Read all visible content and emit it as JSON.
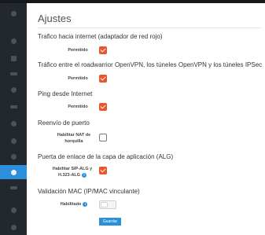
{
  "page": {
    "title": "Ajustes"
  },
  "sidebar": {
    "icons": [
      "globe-icon",
      "shield-icon",
      "shuffle-icon",
      "users-icon",
      "list-icon",
      "chart-icon",
      "pulse-icon",
      "link-icon",
      "gear-icon",
      "stack-icon",
      "search-icon",
      "info-icon"
    ],
    "active_icon": "gear-icon"
  },
  "sections": {
    "internet": {
      "title": "Trafico hacia internet (adaptador de red rojo)",
      "label": "Permitido",
      "checked": true
    },
    "vpn": {
      "title": "Tráfico entre el roadwarrior OpenVPN, los túneles OpenVPN y los túneles IPSec",
      "label": "Permitido",
      "checked": true
    },
    "ping": {
      "title": "Ping desde Internet",
      "label": "Permitido",
      "checked": true
    },
    "port_forward": {
      "title": "Reenvío de puerto",
      "label_line1": "Habilitar NAT de",
      "label_line2": "horquilla",
      "checked": false
    },
    "alg": {
      "title": "Puerta de enlace de la capa de aplicación (ALG)",
      "label_line1": "Habilitar SIP-ALG y",
      "label_line2": "H.323-ALG",
      "info_glyph": "i",
      "checked": true
    },
    "mac": {
      "title": "Validación MAC (IP/MAC vinculante)",
      "label": "Habilitado",
      "info_glyph": "i",
      "enabled": false
    }
  },
  "actions": {
    "save_label": "Guardar"
  },
  "colors": {
    "accent": "#2b8fd9",
    "checkbox_checked": "#e8572b",
    "sidebar_bg": "#23282e"
  }
}
